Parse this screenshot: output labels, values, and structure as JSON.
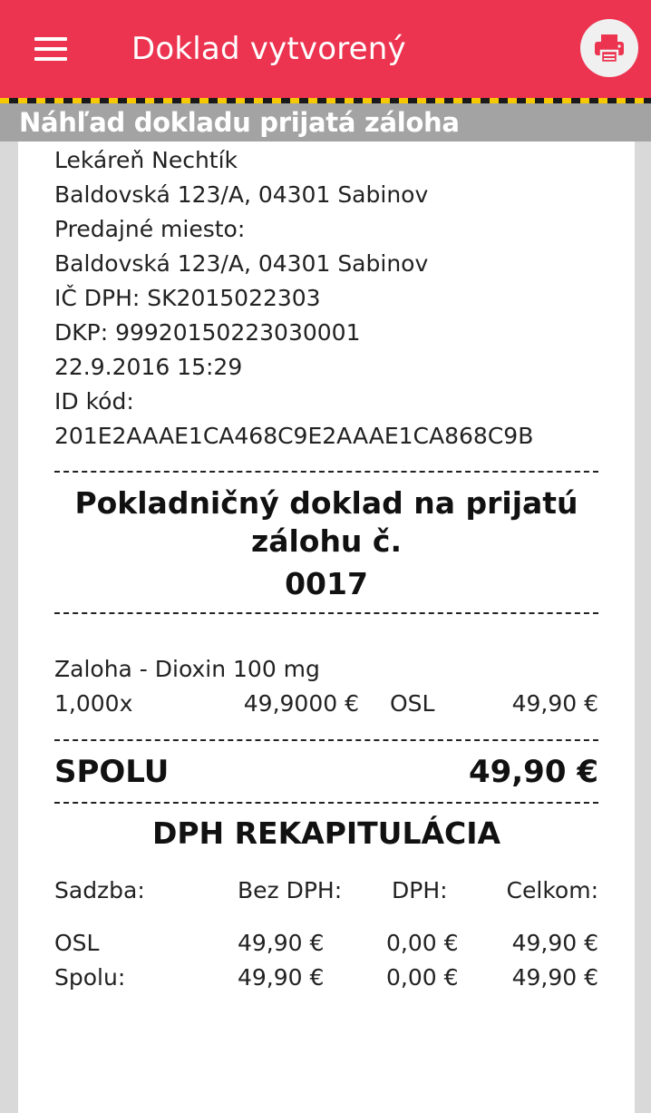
{
  "appbar": {
    "title": "Doklad vytvorený",
    "menu_icon": "hamburger-menu-icon",
    "print_icon": "printer-icon",
    "accent": "#ec3450"
  },
  "preview": {
    "header": "Náhľad dokladu prijatá záloha"
  },
  "store": {
    "lines": [
      "Lekáreň Nechtík",
      "Baldovská 123/A, 04301 Sabinov",
      "Predajné miesto:",
      "Baldovská 123/A, 04301 Sabinov",
      "IČ DPH:  SK2015022303",
      "DKP:  99920150223030001",
      "22.9.2016 15:29",
      "ID kód:",
      "201E2AAAE1CA468C9E2AAAE1CA868C9B"
    ]
  },
  "document": {
    "title_line1": "Pokladničný doklad na prijatú",
    "title_line2": "zálohu č.",
    "number": "0017"
  },
  "item": {
    "name": "Zaloha - Dioxin 100 mg",
    "quantity": "1,000x",
    "unit_price": "49,9000 €",
    "vat_code": "OSL",
    "total": "49,90 €"
  },
  "total": {
    "label": "SPOLU",
    "value": "49,90 €"
  },
  "vat": {
    "title": "DPH REKAPITULÁCIA",
    "headers": [
      "Sadzba:",
      "Bez DPH:",
      "DPH:",
      "Celkom:"
    ],
    "rows": [
      [
        "OSL",
        "49,90 €",
        "0,00 €",
        "49,90 €"
      ],
      [
        "Spolu:",
        "49,90 €",
        "0,00 €",
        "49,90 €"
      ]
    ]
  }
}
